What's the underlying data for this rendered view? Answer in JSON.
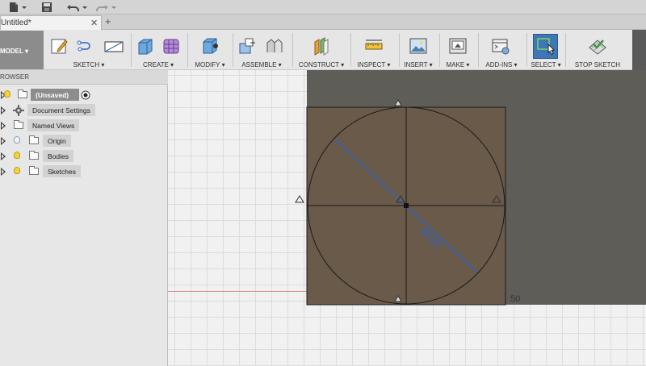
{
  "quick_access": {
    "file_icon": "file-icon",
    "save_icon": "save-icon",
    "undo_icon": "undo-icon",
    "redo_icon": "redo-icon"
  },
  "tabs": [
    {
      "label": "Untitled*"
    }
  ],
  "workspace": {
    "label": "MODEL ▾"
  },
  "toolbar": {
    "groups": [
      {
        "label": "SKETCH ▾"
      },
      {
        "label": "CREATE ▾"
      },
      {
        "label": "MODIFY ▾"
      },
      {
        "label": "ASSEMBLE ▾"
      },
      {
        "label": "CONSTRUCT ▾"
      },
      {
        "label": "INSPECT ▾"
      },
      {
        "label": "INSERT ▾"
      },
      {
        "label": "MAKE ▾"
      },
      {
        "label": "ADD-INS ▾"
      },
      {
        "label": "SELECT ▾"
      },
      {
        "label": "STOP SKETCH"
      }
    ]
  },
  "browser": {
    "title": "ROWSER",
    "root": {
      "label": "(Unsaved)"
    },
    "items": [
      {
        "label": "Document Settings",
        "icon": "gear-icon"
      },
      {
        "label": "Named Views",
        "icon": "folder-icon"
      },
      {
        "label": "Origin",
        "icon": "folder-icon",
        "bulb": "off"
      },
      {
        "label": "Bodies",
        "icon": "folder-icon",
        "bulb": "on"
      },
      {
        "label": "Sketches",
        "icon": "folder-icon",
        "bulb": "on"
      }
    ]
  },
  "sketch": {
    "diameter_dimension": "Ø150",
    "edge_dimension": "50",
    "colors": {
      "sketch_line": "#1a1a1a",
      "dimension": "#2f63c4",
      "sketch_fill": "#6b5a47",
      "background_dark": "#5f5d58",
      "axis_red": "#e58a8a"
    }
  }
}
